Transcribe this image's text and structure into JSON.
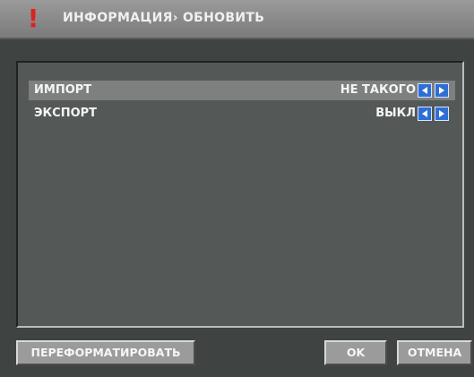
{
  "header": {
    "alert_icon": "warning-exclamation-icon",
    "title": "ИНФОРМАЦИЯ› ОБНОВИТЬ"
  },
  "settings": {
    "rows": [
      {
        "label": "ИМПОРТ",
        "value": "НЕ ТАКОГО"
      },
      {
        "label": "ЭКСПОРТ",
        "value": "ВЫКЛ"
      }
    ]
  },
  "buttons": {
    "reformat": "ПЕРЕФОРМАТИРОВАТЬ",
    "ok": "OK",
    "cancel": "ОТМЕНА"
  },
  "colors": {
    "accent": "#2e6fd6",
    "alert": "#e02020",
    "highlight_row": "#7d807f"
  }
}
